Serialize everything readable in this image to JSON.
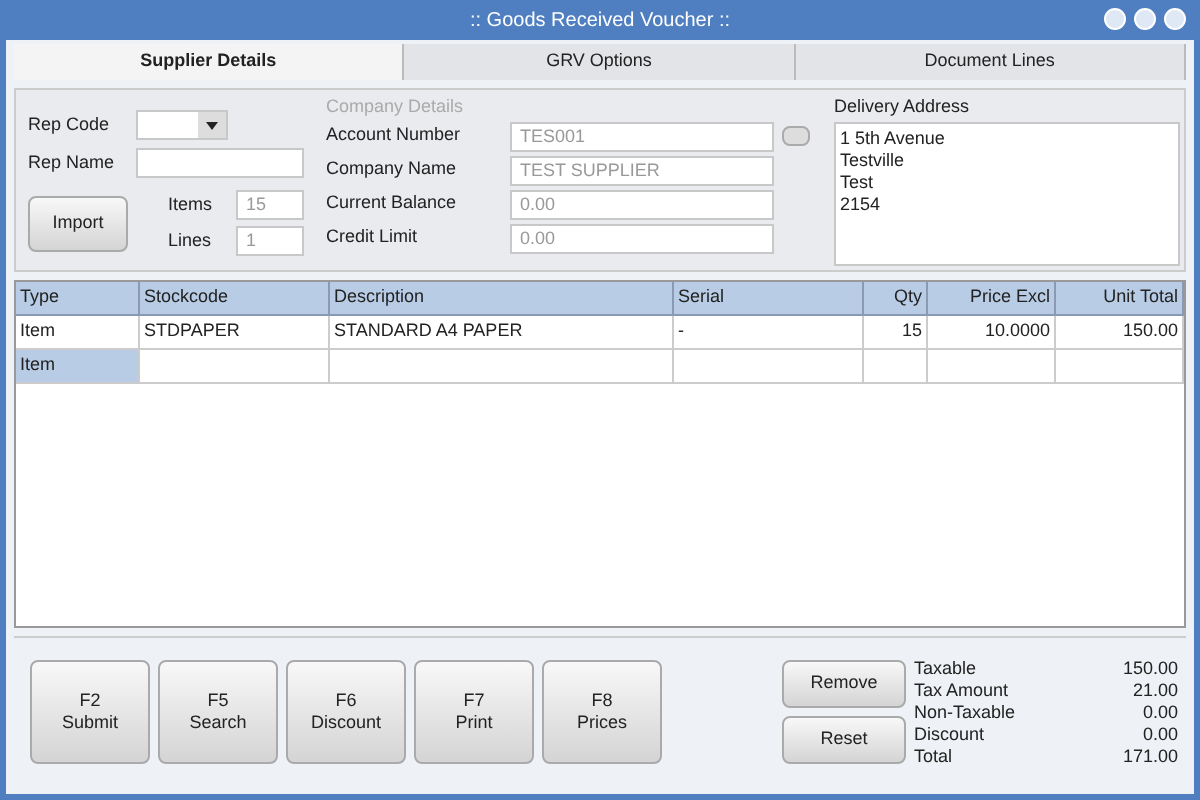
{
  "window": {
    "title": ":: Goods Received Voucher ::"
  },
  "tabs": [
    {
      "label": "Supplier Details",
      "selected": true
    },
    {
      "label": "GRV Options",
      "selected": false
    },
    {
      "label": "Document Lines",
      "selected": false
    }
  ],
  "rep": {
    "rep_code_label": "Rep Code",
    "rep_name_label": "Rep Name",
    "import_button": "Import",
    "items_label": "Items",
    "items_value": "15",
    "lines_label": "Lines",
    "lines_value": "1"
  },
  "company_details": {
    "legend": "Company Details",
    "fields": [
      {
        "label": "Account Number",
        "value": "TES001",
        "disabled": true
      },
      {
        "label": "Company Name",
        "value": "TEST SUPPLIER",
        "disabled": true
      },
      {
        "label": "Current Balance",
        "value": "0.00",
        "disabled": true
      },
      {
        "label": "Credit Limit",
        "value": "0.00",
        "disabled": true
      }
    ]
  },
  "delivery_address": {
    "legend": "Delivery Address",
    "lines": [
      "1 5th Avenue",
      "Testville",
      "Test",
      "2154"
    ]
  },
  "table": {
    "columns": [
      "Type",
      "Stockcode",
      "Description",
      "Serial",
      "Qty",
      "Price Excl",
      "Unit Total"
    ],
    "rows": [
      {
        "cells": [
          "Item",
          "STDPAPER",
          "STANDARD A4 PAPER",
          "-",
          "15",
          "10.0000",
          "150.00"
        ],
        "selected": false
      },
      {
        "cells": [
          "Item",
          "",
          "",
          "",
          "",
          "",
          ""
        ],
        "selected": true
      }
    ]
  },
  "function_buttons": [
    {
      "key": "F2",
      "label": "Submit"
    },
    {
      "key": "F5",
      "label": "Search"
    },
    {
      "key": "F6",
      "label": "Discount"
    },
    {
      "key": "F7",
      "label": "Print"
    },
    {
      "key": "F8",
      "label": "Prices"
    }
  ],
  "action_buttons": [
    "Remove",
    "Reset"
  ],
  "totals": [
    {
      "label": "Taxable",
      "value": "150.00"
    },
    {
      "label": "Tax Amount",
      "value": "21.00"
    },
    {
      "label": "Non-Taxable",
      "value": "0.00"
    },
    {
      "label": "Discount",
      "value": "0.00"
    },
    {
      "label": "Total",
      "value": "171.00"
    }
  ]
}
